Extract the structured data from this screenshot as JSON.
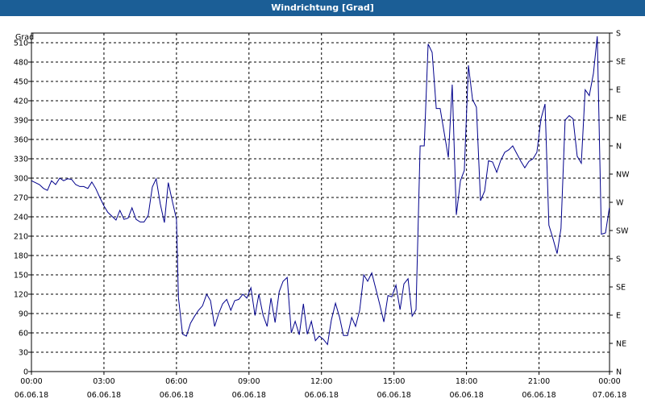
{
  "window": {
    "title": "Windrichtung [Grad]"
  },
  "chart_data": {
    "type": "line",
    "title": "Windrichtung [Grad]",
    "ylabel": "Grad",
    "xlabel": "",
    "ylim": [
      0,
      525
    ],
    "xlim": [
      0,
      23.917
    ],
    "grid": true,
    "legend": "none",
    "colors": {
      "line": "#00008b",
      "grid": "#000000",
      "titlebar": "#1b5e96"
    },
    "y_ticks": [
      0,
      30,
      60,
      90,
      120,
      150,
      180,
      210,
      240,
      270,
      300,
      330,
      360,
      390,
      420,
      450,
      480,
      510
    ],
    "y2_ticks": [
      {
        "value": 0,
        "label": "N"
      },
      {
        "value": 45,
        "label": "NE"
      },
      {
        "value": 90,
        "label": "E"
      },
      {
        "value": 135,
        "label": "SE"
      },
      {
        "value": 180,
        "label": "S"
      },
      {
        "value": 225,
        "label": "SW"
      },
      {
        "value": 270,
        "label": "W"
      },
      {
        "value": 315,
        "label": "NW"
      },
      {
        "value": 360,
        "label": "N"
      },
      {
        "value": 405,
        "label": "NE"
      },
      {
        "value": 450,
        "label": "E"
      },
      {
        "value": 495,
        "label": "SE"
      },
      {
        "value": 540,
        "label": "S"
      }
    ],
    "x_ticks": [
      {
        "value": 0,
        "time": "00:00",
        "date": "06.06.18"
      },
      {
        "value": 3,
        "time": "03:00",
        "date": "06.06.18"
      },
      {
        "value": 6,
        "time": "06:00",
        "date": "06.06.18"
      },
      {
        "value": 9,
        "time": "09:00",
        "date": "06.06.18"
      },
      {
        "value": 12,
        "time": "12:00",
        "date": "06.06.18"
      },
      {
        "value": 15,
        "time": "15:00",
        "date": "06.06.18"
      },
      {
        "value": 18,
        "time": "18:00",
        "date": "06.06.18"
      },
      {
        "value": 21,
        "time": "21:00",
        "date": "06.06.18"
      },
      {
        "value": 23.917,
        "time": "00:00",
        "date": "07.06.18"
      }
    ],
    "series": [
      {
        "points": [
          [
            0.0,
            296
          ],
          [
            0.33,
            290
          ],
          [
            0.5,
            284
          ],
          [
            0.66,
            281
          ],
          [
            0.83,
            296
          ],
          [
            1.0,
            290
          ],
          [
            1.17,
            300
          ],
          [
            1.33,
            296
          ],
          [
            1.5,
            299
          ],
          [
            1.66,
            298
          ],
          [
            1.83,
            290
          ],
          [
            2.0,
            287
          ],
          [
            2.16,
            287
          ],
          [
            2.33,
            284
          ],
          [
            2.5,
            294
          ],
          [
            2.66,
            284
          ],
          [
            2.83,
            270
          ],
          [
            3.0,
            257
          ],
          [
            3.16,
            247
          ],
          [
            3.33,
            241
          ],
          [
            3.5,
            235
          ],
          [
            3.66,
            250
          ],
          [
            3.83,
            236
          ],
          [
            4.0,
            238
          ],
          [
            4.16,
            254
          ],
          [
            4.33,
            236
          ],
          [
            4.5,
            232
          ],
          [
            4.66,
            232
          ],
          [
            4.83,
            242
          ],
          [
            5.0,
            286
          ],
          [
            5.16,
            299
          ],
          [
            5.33,
            260
          ],
          [
            5.5,
            231
          ],
          [
            5.66,
            293
          ],
          [
            5.83,
            264
          ],
          [
            6.0,
            236
          ],
          [
            6.08,
            115
          ],
          [
            6.25,
            58
          ],
          [
            6.41,
            55
          ],
          [
            6.58,
            75
          ],
          [
            6.75,
            86
          ],
          [
            6.91,
            95
          ],
          [
            7.08,
            102
          ],
          [
            7.25,
            120
          ],
          [
            7.41,
            110
          ],
          [
            7.58,
            70
          ],
          [
            7.75,
            90
          ],
          [
            7.91,
            105
          ],
          [
            8.08,
            112
          ],
          [
            8.25,
            95
          ],
          [
            8.41,
            110
          ],
          [
            8.58,
            112
          ],
          [
            8.75,
            120
          ],
          [
            8.91,
            114
          ],
          [
            9.08,
            130
          ],
          [
            9.25,
            87
          ],
          [
            9.41,
            120
          ],
          [
            9.58,
            88
          ],
          [
            9.75,
            70
          ],
          [
            9.91,
            114
          ],
          [
            10.08,
            76
          ],
          [
            10.25,
            124
          ],
          [
            10.41,
            140
          ],
          [
            10.58,
            146
          ],
          [
            10.75,
            60
          ],
          [
            10.91,
            78
          ],
          [
            11.08,
            57
          ],
          [
            11.25,
            105
          ],
          [
            11.41,
            58
          ],
          [
            11.58,
            78
          ],
          [
            11.75,
            48
          ],
          [
            11.91,
            55
          ],
          [
            12.08,
            50
          ],
          [
            12.25,
            42
          ],
          [
            12.41,
            80
          ],
          [
            12.58,
            106
          ],
          [
            12.75,
            84
          ],
          [
            12.91,
            56
          ],
          [
            13.08,
            56
          ],
          [
            13.25,
            84
          ],
          [
            13.41,
            70
          ],
          [
            13.58,
            95
          ],
          [
            13.75,
            150
          ],
          [
            13.91,
            140
          ],
          [
            14.08,
            153
          ],
          [
            14.25,
            128
          ],
          [
            14.41,
            104
          ],
          [
            14.58,
            77
          ],
          [
            14.75,
            118
          ],
          [
            14.91,
            116
          ],
          [
            15.08,
            134
          ],
          [
            15.25,
            96
          ],
          [
            15.41,
            136
          ],
          [
            15.58,
            144
          ],
          [
            15.75,
            86
          ],
          [
            15.91,
            96
          ],
          [
            16.08,
            350
          ],
          [
            16.25,
            350
          ],
          [
            16.41,
            508
          ],
          [
            16.58,
            495
          ],
          [
            16.75,
            408
          ],
          [
            16.91,
            408
          ],
          [
            17.08,
            370
          ],
          [
            17.25,
            332
          ],
          [
            17.41,
            445
          ],
          [
            17.58,
            243
          ],
          [
            17.75,
            296
          ],
          [
            17.91,
            312
          ],
          [
            18.08,
            475
          ],
          [
            18.25,
            422
          ],
          [
            18.41,
            410
          ],
          [
            18.58,
            265
          ],
          [
            18.75,
            280
          ],
          [
            18.91,
            327
          ],
          [
            19.08,
            325
          ],
          [
            19.25,
            309
          ],
          [
            19.41,
            327
          ],
          [
            19.58,
            340
          ],
          [
            19.75,
            344
          ],
          [
            19.91,
            350
          ],
          [
            20.08,
            338
          ],
          [
            20.25,
            326
          ],
          [
            20.41,
            316
          ],
          [
            20.58,
            326
          ],
          [
            20.75,
            330
          ],
          [
            20.91,
            340
          ],
          [
            21.08,
            392
          ],
          [
            21.25,
            415
          ],
          [
            21.41,
            227
          ],
          [
            21.58,
            206
          ],
          [
            21.75,
            183
          ],
          [
            21.91,
            222
          ],
          [
            22.08,
            390
          ],
          [
            22.25,
            397
          ],
          [
            22.41,
            392
          ],
          [
            22.58,
            334
          ],
          [
            22.75,
            323
          ],
          [
            22.91,
            437
          ],
          [
            23.08,
            428
          ],
          [
            23.25,
            462
          ],
          [
            23.41,
            520
          ],
          [
            23.58,
            213
          ],
          [
            23.75,
            215
          ],
          [
            23.91,
            254
          ]
        ]
      }
    ]
  }
}
